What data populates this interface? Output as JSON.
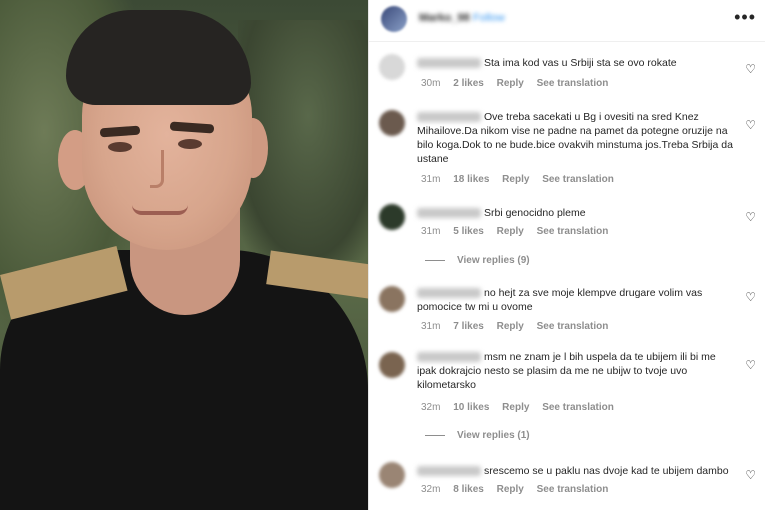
{
  "header": {
    "username": "Marko_98",
    "follow_label": "Follow",
    "more_icon": "more-horizontal-icon"
  },
  "comments": [
    {
      "text": "Sta ima kod vas u Srbiji sta se ovo rokate",
      "time": "30m",
      "likes": "2 likes",
      "reply": "Reply",
      "translate": "See translation",
      "avatar_color": "#d8d8d8"
    },
    {
      "text": "Ove treba sacekati u Bg i ovesiti na sred Knez Mihailove.Da nikom vise ne padne na pamet da potegne oruzije na bilo koga.Dok to ne bude.bice ovakvih minstuma jos.Treba Srbija da ustane",
      "time": "31m",
      "likes": "18 likes",
      "reply": "Reply",
      "translate": "See translation",
      "avatar_color": "#6b5a4e"
    },
    {
      "text": "Srbi genocidno pleme",
      "time": "31m",
      "likes": "5 likes",
      "reply": "Reply",
      "translate": "See translation",
      "avatar_color": "#2c3a2a",
      "view_replies": "View replies (9)"
    },
    {
      "text": "no hejt za sve moje klempve drugare volim vas pomocice tw mi u ovome",
      "time": "31m",
      "likes": "7 likes",
      "reply": "Reply",
      "translate": "See translation",
      "avatar_color": "#8a7460"
    },
    {
      "text": "msm ne znam je l bih uspela da te ubijem ili bi me ipak dokrajcio nesto se plasim da me ne ubijw to tvoje uvo kilometarsko",
      "time": "32m",
      "likes": "10 likes",
      "reply": "Reply",
      "translate": "See translation",
      "avatar_color": "#7a6450",
      "view_replies": "View replies (1)"
    },
    {
      "text": "srescemo se u paklu nas dvoje kad te ubijem dambo",
      "time": "32m",
      "likes": "8 likes",
      "reply": "Reply",
      "translate": "See translation",
      "avatar_color": "#9a8574"
    }
  ],
  "heart_icon": "heart-outline-icon"
}
